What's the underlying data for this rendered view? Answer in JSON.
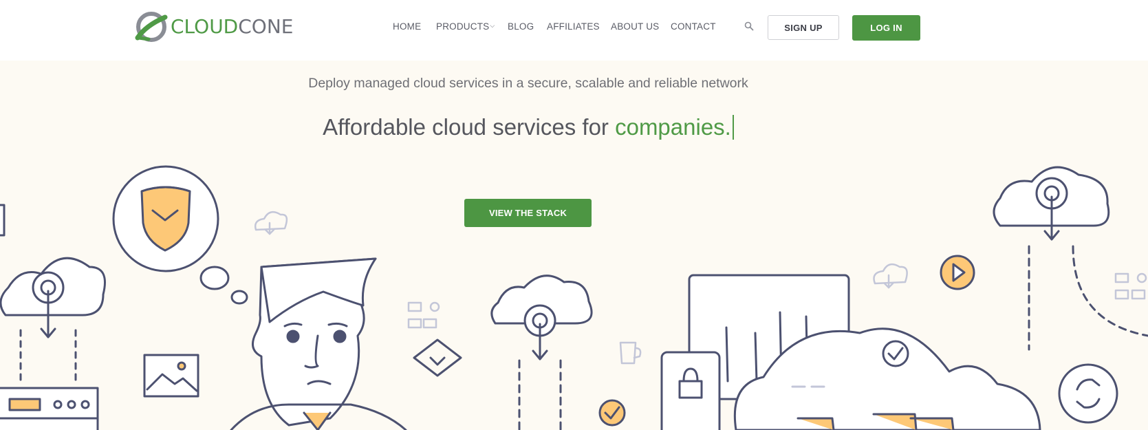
{
  "brand": {
    "name_part1": "CLOUD",
    "name_part2": "CONE",
    "color_green": "#4f9a46",
    "color_gray": "#6e7079"
  },
  "nav": {
    "items": [
      {
        "label": "HOME"
      },
      {
        "label": "PRODUCTS",
        "dropdown": true
      },
      {
        "label": "BLOG"
      },
      {
        "label": "AFFILIATES"
      },
      {
        "label": "ABOUT US"
      },
      {
        "label": "CONTACT"
      }
    ],
    "search_icon": "search-icon"
  },
  "auth": {
    "signup_label": "SIGN UP",
    "login_label": "LOG IN"
  },
  "hero": {
    "tagline": "Deploy managed cloud services in a secure, scalable and reliable network",
    "headline_prefix": "Affordable cloud services for ",
    "headline_accent": "companies.",
    "cta_label": "VIEW THE STACK"
  },
  "colors": {
    "accent": "#4d9643",
    "background": "#fdfaf3",
    "illustration_stroke": "#4c5170",
    "illustration_fill": "#fdc877"
  }
}
